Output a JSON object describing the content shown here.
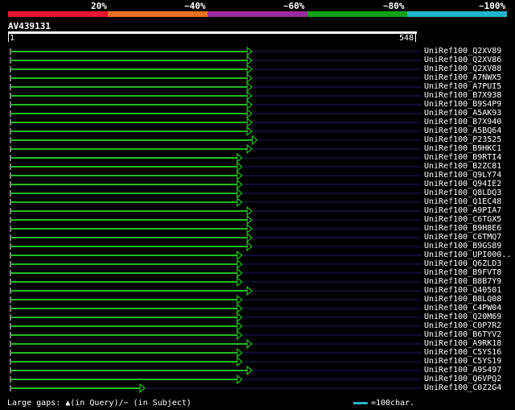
{
  "legend": {
    "labels": [
      "20%",
      "~40%",
      "~60%",
      "~80%",
      "~100%"
    ],
    "colors": [
      "#e8142f",
      "#e87320",
      "#9a2a9a",
      "#14a014",
      "#1fb5c9"
    ]
  },
  "query": {
    "name": "AV439131",
    "start_label": "1",
    "end_label": "548"
  },
  "chart_data": {
    "type": "alignment",
    "query_length": 548,
    "hit_color": "#22bb22",
    "line_color": "#1a1a66",
    "hits": [
      {
        "name": "UniRef100_Q2XV89",
        "start": 1,
        "end": 548
      },
      {
        "name": "UniRef100_Q2XV86",
        "start": 1,
        "end": 548
      },
      {
        "name": "UniRef100_Q2XV88",
        "start": 1,
        "end": 548
      },
      {
        "name": "UniRef100_A7NWX5",
        "start": 1,
        "end": 548
      },
      {
        "name": "UniRef100_A7PUI5",
        "start": 1,
        "end": 548
      },
      {
        "name": "UniRef100_B7X938",
        "start": 1,
        "end": 548
      },
      {
        "name": "UniRef100_B9S4P9",
        "start": 1,
        "end": 548
      },
      {
        "name": "UniRef100_A5AK93",
        "start": 1,
        "end": 548
      },
      {
        "name": "UniRef100_B7X940",
        "start": 1,
        "end": 548
      },
      {
        "name": "UniRef100_A5BQ64",
        "start": 1,
        "end": 548
      },
      {
        "name": "UniRef100_P23525",
        "start": 1,
        "end": 548
      },
      {
        "name": "UniRef100_B9HKC1",
        "start": 1,
        "end": 548
      },
      {
        "name": "UniRef100_B9RTI4",
        "start": 1,
        "end": 548
      },
      {
        "name": "UniRef100_B2ZC81",
        "start": 1,
        "end": 548
      },
      {
        "name": "UniRef100_Q9LY74",
        "start": 1,
        "end": 548
      },
      {
        "name": "UniRef100_Q94IE2",
        "start": 1,
        "end": 548
      },
      {
        "name": "UniRef100_Q8LDQ3",
        "start": 1,
        "end": 548
      },
      {
        "name": "UniRef100_Q1EC48",
        "start": 1,
        "end": 548
      },
      {
        "name": "UniRef100_A9PIA7",
        "start": 1,
        "end": 548
      },
      {
        "name": "UniRef100_C6TGX5",
        "start": 1,
        "end": 548
      },
      {
        "name": "UniRef100_B9H8E6",
        "start": 1,
        "end": 548
      },
      {
        "name": "UniRef100_C6TMQ7",
        "start": 1,
        "end": 548
      },
      {
        "name": "UniRef100_B9GS89",
        "start": 1,
        "end": 548
      },
      {
        "name": "UniRef100_UPI000..",
        "start": 1,
        "end": 548
      },
      {
        "name": "UniRef100_Q6ZLD3",
        "start": 1,
        "end": 548
      },
      {
        "name": "UniRef100_B9FVT8",
        "start": 1,
        "end": 548
      },
      {
        "name": "UniRef100_B8B7Y9",
        "start": 1,
        "end": 548
      },
      {
        "name": "UniRef100_Q40501",
        "start": 1,
        "end": 548
      },
      {
        "name": "UniRef100_B8LQ08",
        "start": 1,
        "end": 548
      },
      {
        "name": "UniRef100_C4PW04",
        "start": 1,
        "end": 548
      },
      {
        "name": "UniRef100_Q20M69",
        "start": 1,
        "end": 548
      },
      {
        "name": "UniRef100_C0P7R2",
        "start": 1,
        "end": 548
      },
      {
        "name": "UniRef100_B6TYV2",
        "start": 1,
        "end": 548
      },
      {
        "name": "UniRef100_A9RK18",
        "start": 1,
        "end": 548
      },
      {
        "name": "UniRef100_C5YS16",
        "start": 1,
        "end": 548
      },
      {
        "name": "UniRef100_C5YS19",
        "start": 1,
        "end": 548
      },
      {
        "name": "UniRef100_A9S497",
        "start": 1,
        "end": 548
      },
      {
        "name": "UniRef100_Q6VPQ2",
        "start": 1,
        "end": 548
      },
      {
        "name": "UniRef100_C0Z2G4",
        "start": 1,
        "end": 548
      }
    ],
    "arrow_ends": [
      548,
      548,
      548,
      548,
      548,
      548,
      548,
      548,
      548,
      548,
      560,
      548,
      525,
      525,
      525,
      525,
      525,
      525,
      548,
      548,
      548,
      548,
      548,
      525,
      525,
      525,
      525,
      548,
      525,
      525,
      525,
      525,
      525,
      548,
      525,
      525,
      548,
      525,
      300
    ]
  },
  "footer": {
    "gaps_label": "Large gaps: ▲(in Query)/− (in Subject)",
    "scale_label": "=100char."
  }
}
